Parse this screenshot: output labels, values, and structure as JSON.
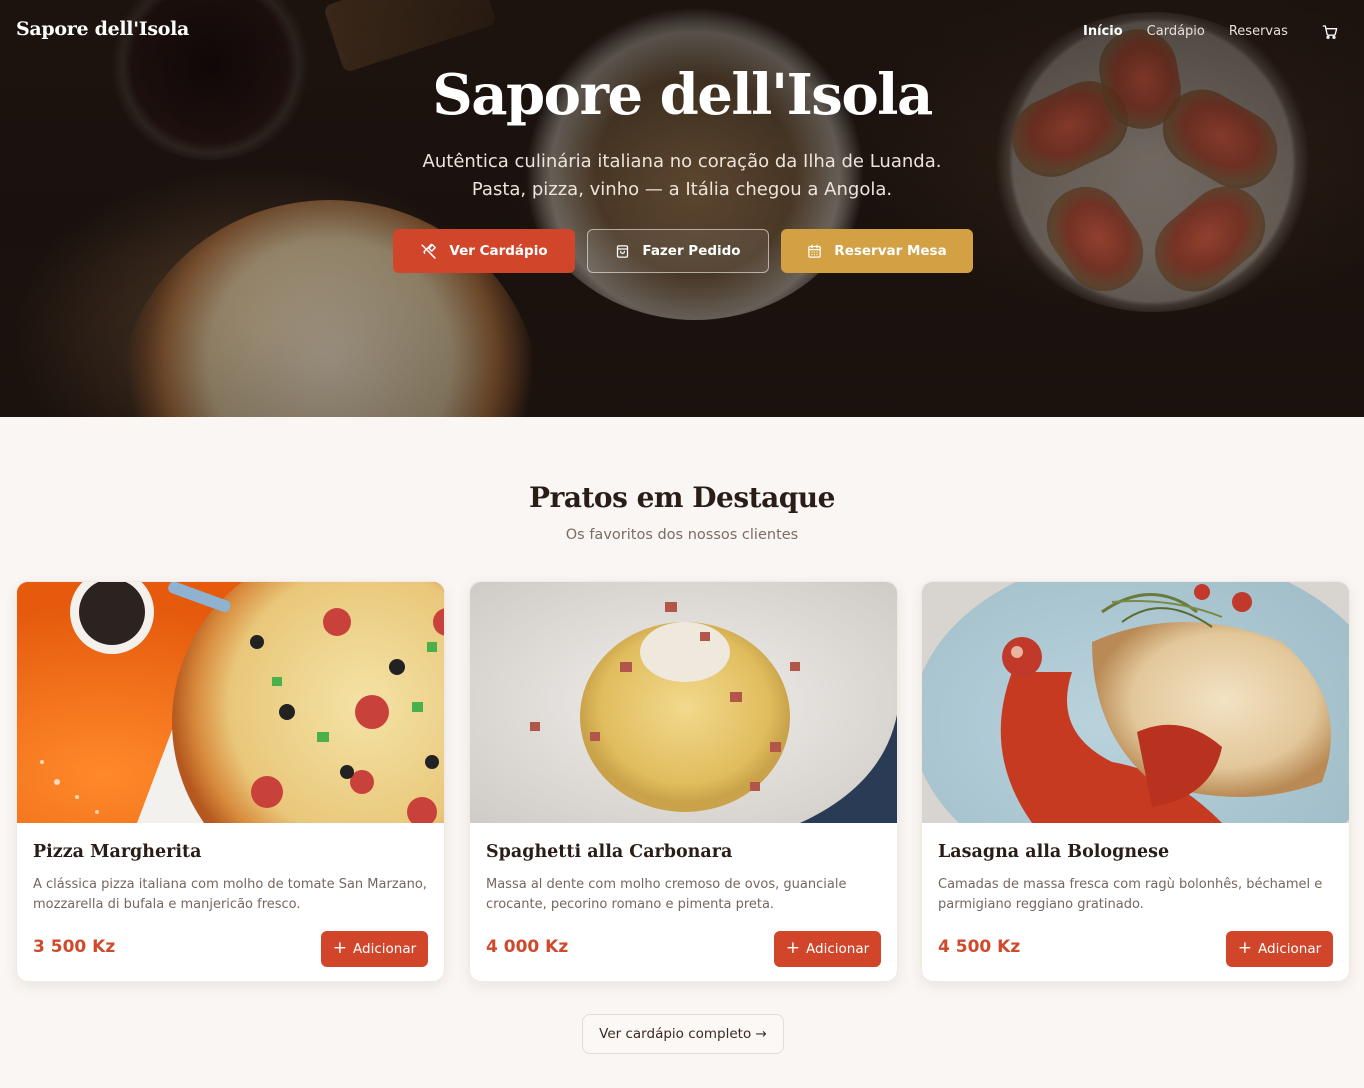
{
  "brand": {
    "name": "Sapore dell'Isola"
  },
  "nav": {
    "links": [
      {
        "label": "Início"
      },
      {
        "label": "Cardápio"
      },
      {
        "label": "Reservas"
      }
    ],
    "cart_icon": "cart-icon"
  },
  "hero": {
    "title": "Sapore dell'Isola",
    "subtitle_line1": "Autêntica culinária italiana no coração da Ilha de Luanda.",
    "subtitle_line2": "Pasta, pizza, vinho — a Itália chegou a Angola.",
    "buttons": {
      "menu": {
        "label": "Ver Cardápio",
        "icon": "utensils-icon"
      },
      "order": {
        "label": "Fazer Pedido",
        "icon": "shopping-bag-icon"
      },
      "reserve": {
        "label": "Reservar Mesa",
        "icon": "calendar-icon"
      }
    }
  },
  "featured": {
    "title": "Pratos em Destaque",
    "subtitle": "Os favoritos dos nossos clientes",
    "items": [
      {
        "name": "Pizza Margherita",
        "description": "A clássica pizza italiana com molho de tomate San Marzano, mozzarella di bufala e manjericão fresco.",
        "price": "3 500 Kz",
        "button": "Adicionar"
      },
      {
        "name": "Spaghetti alla Carbonara",
        "description": "Massa al dente com molho cremoso de ovos, guanciale crocante, pecorino romano e pimenta preta.",
        "price": "4 000 Kz",
        "button": "Adicionar"
      },
      {
        "name": "Lasagna alla Bolognese",
        "description": "Camadas de massa fresca com ragù bolonhês, béchamel e parmigiano reggiano gratinado.",
        "price": "4 500 Kz",
        "button": "Adicionar"
      }
    ],
    "full_menu_button": "Ver cardápio completo →"
  },
  "colors": {
    "primary": "#d1462a",
    "gold": "#d3a044",
    "background": "#faf6f3",
    "price": "#cf4a2c"
  }
}
